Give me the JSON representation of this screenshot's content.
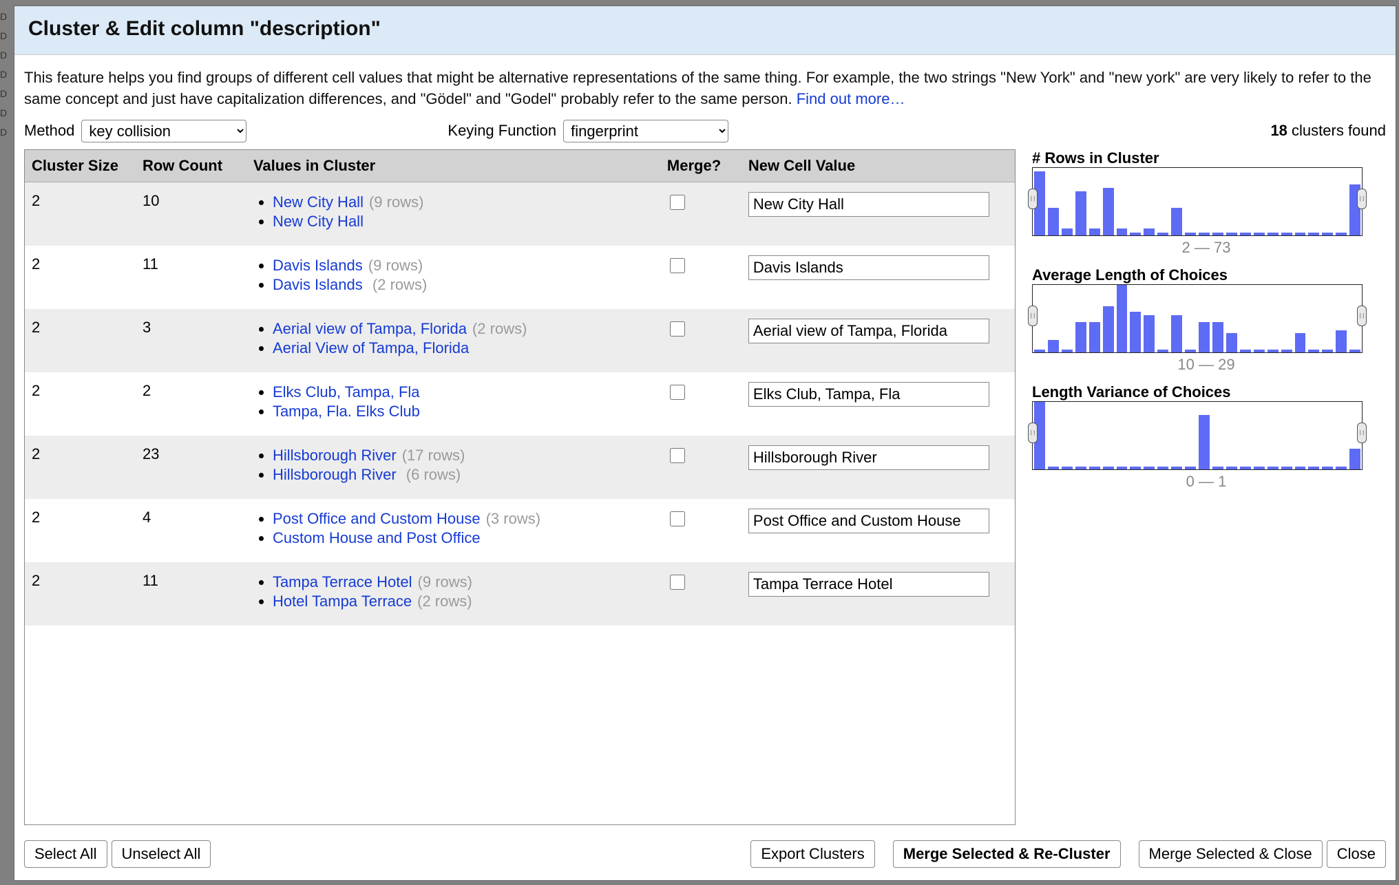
{
  "edge_markers": [
    "D",
    "D",
    "D",
    "D",
    "D",
    "D",
    "D"
  ],
  "dialog": {
    "title": "Cluster & Edit column \"description\"",
    "intro_text": "This feature helps you find groups of different cell values that might be alternative representations of the same thing. For example, the two strings \"New York\" and \"new york\" are very likely to refer to the same concept and just have capitalization differences, and \"Gödel\" and \"Godel\" probably refer to the same person. ",
    "intro_link": "Find out more…",
    "method_label": "Method",
    "method_value": "key collision",
    "keying_label": "Keying Function",
    "keying_value": "fingerprint",
    "clusters_found_count": "18",
    "clusters_found_suffix": " clusters found",
    "table": {
      "headers": {
        "cluster_size": "Cluster Size",
        "row_count": "Row Count",
        "values": "Values in Cluster",
        "merge": "Merge?",
        "new_val": "New Cell Value"
      },
      "rows": [
        {
          "size": "2",
          "row_count": "10",
          "values": [
            {
              "label": "New City Hall",
              "rows": "(9 rows)"
            },
            {
              "label": "New City Hall ",
              "rows": ""
            }
          ],
          "new_value": "New City Hall"
        },
        {
          "size": "2",
          "row_count": "11",
          "values": [
            {
              "label": "Davis Islands",
              "rows": "(9 rows)"
            },
            {
              "label": "Davis Islands ",
              "rows": "(2 rows)"
            }
          ],
          "new_value": "Davis Islands"
        },
        {
          "size": "2",
          "row_count": "3",
          "values": [
            {
              "label": "Aerial view of Tampa, Florida",
              "rows": "(2 rows)"
            },
            {
              "label": "Aerial View of Tampa, Florida",
              "rows": ""
            }
          ],
          "new_value": "Aerial view of Tampa, Florida"
        },
        {
          "size": "2",
          "row_count": "2",
          "values": [
            {
              "label": "Elks Club, Tampa, Fla",
              "rows": ""
            },
            {
              "label": "Tampa, Fla. Elks Club",
              "rows": ""
            }
          ],
          "new_value": "Elks Club, Tampa, Fla"
        },
        {
          "size": "2",
          "row_count": "23",
          "values": [
            {
              "label": "Hillsborough River",
              "rows": "(17 rows)"
            },
            {
              "label": "Hillsborough River ",
              "rows": "(6 rows)"
            }
          ],
          "new_value": "Hillsborough River"
        },
        {
          "size": "2",
          "row_count": "4",
          "values": [
            {
              "label": "Post Office and Custom House",
              "rows": "(3 rows)"
            },
            {
              "label": "Custom House and Post Office",
              "rows": ""
            }
          ],
          "new_value": "Post Office and Custom House"
        },
        {
          "size": "2",
          "row_count": "11",
          "values": [
            {
              "label": "Tampa Terrace Hotel",
              "rows": "(9 rows)"
            },
            {
              "label": "Hotel Tampa Terrace",
              "rows": "(2 rows)"
            }
          ],
          "new_value": "Tampa Terrace Hotel"
        }
      ]
    },
    "sidebar": {
      "hist1": {
        "title": "# Rows in Cluster",
        "range": "2 — 73",
        "bars": [
          95,
          40,
          10,
          65,
          10,
          70,
          10,
          4,
          10,
          4,
          40,
          4,
          4,
          4,
          4,
          4,
          4,
          4,
          4,
          4,
          4,
          4,
          4,
          75
        ]
      },
      "hist2": {
        "title": "Average Length of Choices",
        "range": "10 — 29",
        "bars": [
          4,
          18,
          4,
          45,
          45,
          68,
          100,
          60,
          55,
          4,
          55,
          4,
          45,
          45,
          28,
          4,
          4,
          4,
          4,
          28,
          4,
          4,
          32,
          4
        ]
      },
      "hist3": {
        "title": "Length Variance of Choices",
        "range": "0 — 1",
        "bars": [
          100,
          4,
          4,
          4,
          4,
          4,
          4,
          4,
          4,
          4,
          4,
          4,
          80,
          4,
          4,
          4,
          4,
          4,
          4,
          4,
          4,
          4,
          4,
          30
        ]
      }
    },
    "footer": {
      "select_all": "Select All",
      "unselect_all": "Unselect All",
      "export": "Export Clusters",
      "merge_recluster": "Merge Selected & Re-Cluster",
      "merge_close": "Merge Selected & Close",
      "close": "Close"
    }
  }
}
